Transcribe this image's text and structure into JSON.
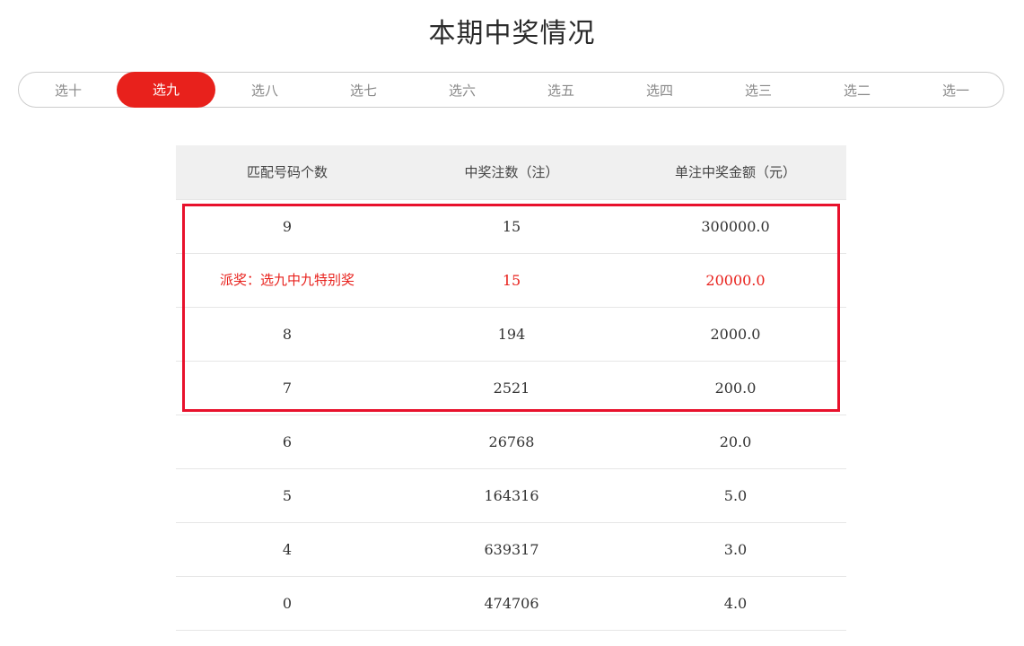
{
  "page_title": "本期中奖情况",
  "tabs": [
    {
      "label": "选十",
      "active": false
    },
    {
      "label": "选九",
      "active": true
    },
    {
      "label": "选八",
      "active": false
    },
    {
      "label": "选七",
      "active": false
    },
    {
      "label": "选六",
      "active": false
    },
    {
      "label": "选五",
      "active": false
    },
    {
      "label": "选四",
      "active": false
    },
    {
      "label": "选三",
      "active": false
    },
    {
      "label": "选二",
      "active": false
    },
    {
      "label": "选一",
      "active": false
    }
  ],
  "table": {
    "headers": [
      "匹配号码个数",
      "中奖注数（注）",
      "单注中奖金额（元）"
    ],
    "rows": [
      {
        "match": "9",
        "count": "15",
        "amount": "300000.0"
      },
      {
        "match": "派奖：选九中九特别奖",
        "count": "15",
        "amount": "20000.0"
      },
      {
        "match": "8",
        "count": "194",
        "amount": "2000.0"
      },
      {
        "match": "7",
        "count": "2521",
        "amount": "200.0"
      },
      {
        "match": "6",
        "count": "26768",
        "amount": "20.0"
      },
      {
        "match": "5",
        "count": "164316",
        "amount": "5.0"
      },
      {
        "match": "4",
        "count": "639317",
        "amount": "3.0"
      },
      {
        "match": "0",
        "count": "474706",
        "amount": "4.0"
      }
    ]
  },
  "colors": {
    "accent": "#e8211c",
    "highlight_border": "#e8112c",
    "header_bg": "#f0f0f0"
  }
}
